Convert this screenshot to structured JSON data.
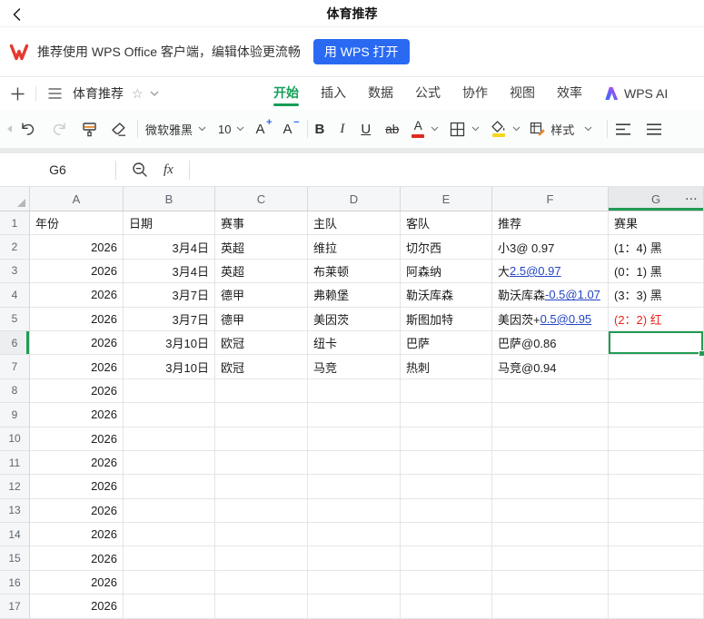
{
  "app": {
    "title": "体育推荐"
  },
  "banner": {
    "message": "推荐使用 WPS Office 客户端，编辑体验更流畅",
    "open_button_label": "用 WPS 打开",
    "logo_color": "#e5392e",
    "button_color": "#2a6af3"
  },
  "menubar": {
    "doc_title": "体育推荐",
    "tabs": [
      {
        "key": "home",
        "label": "开始",
        "active": true
      },
      {
        "key": "insert",
        "label": "插入",
        "active": false
      },
      {
        "key": "data",
        "label": "数据",
        "active": false
      },
      {
        "key": "formula",
        "label": "公式",
        "active": false
      },
      {
        "key": "collaborate",
        "label": "协作",
        "active": false
      },
      {
        "key": "view",
        "label": "视图",
        "active": false
      },
      {
        "key": "efficiency",
        "label": "效率",
        "active": false
      }
    ],
    "wps_ai_label": "WPS AI"
  },
  "toolbar": {
    "font_name": "微软雅黑",
    "font_size": "10",
    "bold": "B",
    "italic": "I",
    "underline": "U",
    "strike": "ab",
    "color_letter": "A",
    "style_label": "样式",
    "accent_blue": "#2a6af3",
    "font_color_red": "#e02b1f",
    "fill_color_yellow": "#f7d51d"
  },
  "formula_bar": {
    "cell_ref": "G6",
    "fx_label": "fx"
  },
  "sheet": {
    "selected_cell": "G6",
    "selected_row": 6,
    "selected_col": "G",
    "accent_color": "#219c53",
    "link_color": "#2445c4",
    "alert_color": "#e8261d",
    "more_button": "⋯",
    "columns": [
      "A",
      "B",
      "C",
      "D",
      "E",
      "F",
      "G"
    ],
    "rows": [
      {
        "n": 1,
        "cells": [
          {
            "text": "年份"
          },
          {
            "text": "日期"
          },
          {
            "text": "赛事"
          },
          {
            "text": "主队"
          },
          {
            "text": "客队"
          },
          {
            "text": "推荐"
          },
          {
            "text": "赛果"
          }
        ]
      },
      {
        "n": 2,
        "cells": [
          {
            "text": "2026",
            "align": "right"
          },
          {
            "text": "3月4日",
            "align": "right"
          },
          {
            "text": "英超"
          },
          {
            "text": "维拉"
          },
          {
            "text": "切尔西"
          },
          {
            "text": "小3@ 0.97"
          },
          {
            "text": "(1：4) 黑"
          }
        ]
      },
      {
        "n": 3,
        "cells": [
          {
            "text": "2026",
            "align": "right"
          },
          {
            "text": "3月4日",
            "align": "right"
          },
          {
            "text": "英超"
          },
          {
            "text": "布莱顿"
          },
          {
            "text": "阿森纳"
          },
          {
            "parts": [
              {
                "text": "大"
              },
              {
                "text": "2.5@0.97",
                "link": true
              }
            ]
          },
          {
            "text": "(0：1) 黑"
          }
        ]
      },
      {
        "n": 4,
        "cells": [
          {
            "text": "2026",
            "align": "right"
          },
          {
            "text": "3月7日",
            "align": "right"
          },
          {
            "text": "德甲"
          },
          {
            "text": "弗赖堡"
          },
          {
            "text": "勒沃库森"
          },
          {
            "parts": [
              {
                "text": "勒沃库森"
              },
              {
                "text": "-0.5@1.07",
                "link": true
              }
            ]
          },
          {
            "text": "(3：3) 黑"
          }
        ]
      },
      {
        "n": 5,
        "cells": [
          {
            "text": "2026",
            "align": "right"
          },
          {
            "text": "3月7日",
            "align": "right"
          },
          {
            "text": "德甲"
          },
          {
            "text": "美因茨"
          },
          {
            "text": "斯图加特"
          },
          {
            "parts": [
              {
                "text": "美因茨+"
              },
              {
                "text": "0.5@0.95",
                "link": true
              }
            ]
          },
          {
            "text": "(2：2) 红",
            "color": "alert"
          }
        ]
      },
      {
        "n": 6,
        "cells": [
          {
            "text": "2026",
            "align": "right"
          },
          {
            "text": "3月10日",
            "align": "right"
          },
          {
            "text": "欧冠"
          },
          {
            "text": "纽卡"
          },
          {
            "text": "巴萨"
          },
          {
            "text": "巴萨@0.86"
          },
          {
            "text": ""
          }
        ]
      },
      {
        "n": 7,
        "cells": [
          {
            "text": "2026",
            "align": "right"
          },
          {
            "text": "3月10日",
            "align": "right"
          },
          {
            "text": "欧冠"
          },
          {
            "text": "马竞"
          },
          {
            "text": "热刺"
          },
          {
            "text": "马竞@0.94"
          },
          {
            "text": ""
          }
        ]
      },
      {
        "n": 8,
        "cells": [
          {
            "text": "2026",
            "align": "right"
          },
          {},
          {},
          {},
          {},
          {},
          {}
        ]
      },
      {
        "n": 9,
        "cells": [
          {
            "text": "2026",
            "align": "right"
          },
          {},
          {},
          {},
          {},
          {},
          {}
        ]
      },
      {
        "n": 10,
        "cells": [
          {
            "text": "2026",
            "align": "right"
          },
          {},
          {},
          {},
          {},
          {},
          {}
        ]
      },
      {
        "n": 11,
        "cells": [
          {
            "text": "2026",
            "align": "right"
          },
          {},
          {},
          {},
          {},
          {},
          {}
        ]
      },
      {
        "n": 12,
        "cells": [
          {
            "text": "2026",
            "align": "right"
          },
          {},
          {},
          {},
          {},
          {},
          {}
        ]
      },
      {
        "n": 13,
        "cells": [
          {
            "text": "2026",
            "align": "right"
          },
          {},
          {},
          {},
          {},
          {},
          {}
        ]
      },
      {
        "n": 14,
        "cells": [
          {
            "text": "2026",
            "align": "right"
          },
          {},
          {},
          {},
          {},
          {},
          {}
        ]
      },
      {
        "n": 15,
        "cells": [
          {
            "text": "2026",
            "align": "right"
          },
          {},
          {},
          {},
          {},
          {},
          {}
        ]
      },
      {
        "n": 16,
        "cells": [
          {
            "text": "2026",
            "align": "right"
          },
          {},
          {},
          {},
          {},
          {},
          {}
        ]
      },
      {
        "n": 17,
        "cells": [
          {
            "text": "2026",
            "align": "right"
          },
          {},
          {},
          {},
          {},
          {},
          {}
        ]
      }
    ]
  }
}
